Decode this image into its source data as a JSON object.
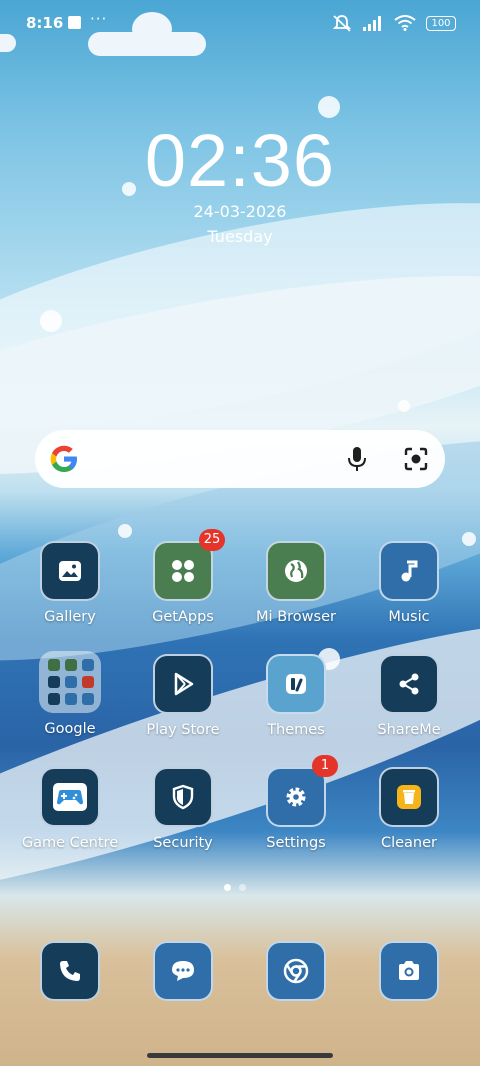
{
  "status_bar": {
    "time": "8:16",
    "more": "···",
    "battery": "100"
  },
  "clock": {
    "time": "02:36",
    "date": "24-03-2026",
    "day": "Tuesday"
  },
  "search": {
    "logo": "google-g-icon",
    "voice_icon": "mic-icon",
    "lens_icon": "camera-lens-icon"
  },
  "apps": [
    {
      "label": "Gallery",
      "icon": "gallery-icon"
    },
    {
      "label": "GetApps",
      "icon": "grid-four-icon",
      "badge": "25"
    },
    {
      "label": "Mi Browser",
      "icon": "globe-icon"
    },
    {
      "label": "Music",
      "icon": "music-note-icon"
    },
    {
      "label": "Google",
      "icon": "folder-icon"
    },
    {
      "label": "Play Store",
      "icon": "play-store-icon"
    },
    {
      "label": "Themes",
      "icon": "themes-icon"
    },
    {
      "label": "ShareMe",
      "icon": "share-icon"
    },
    {
      "label": "Game Centre",
      "icon": "gamepad-icon"
    },
    {
      "label": "Security",
      "icon": "shield-icon"
    },
    {
      "label": "Settings",
      "icon": "gear-icon",
      "badge": "1"
    },
    {
      "label": "Cleaner",
      "icon": "trash-icon"
    }
  ],
  "dock": [
    {
      "icon": "phone-icon"
    },
    {
      "icon": "messages-icon"
    },
    {
      "icon": "chrome-icon"
    },
    {
      "icon": "camera-icon"
    }
  ],
  "colors": {
    "badge": "#e5352b",
    "icon_dark": "#153c59",
    "icon_green": "#4a7d4f",
    "icon_blue": "#2f6ea8"
  }
}
